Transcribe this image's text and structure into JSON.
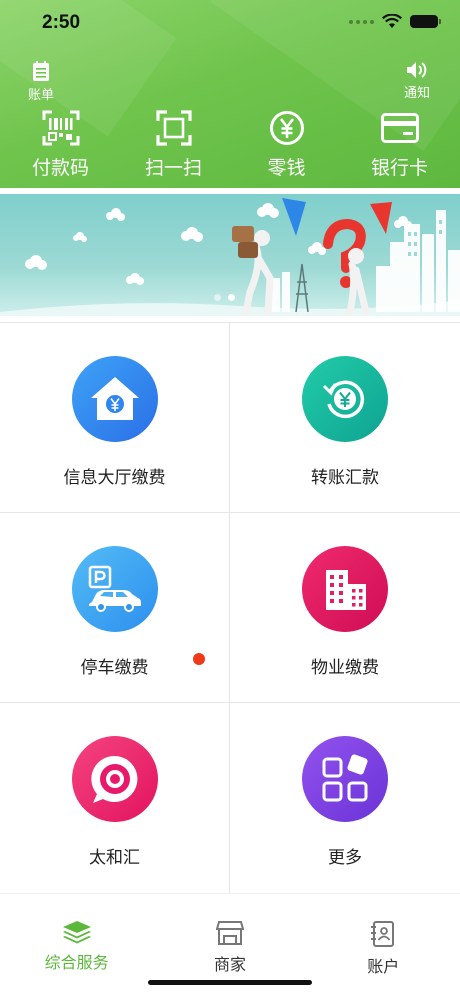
{
  "status_bar": {
    "time": "2:50"
  },
  "header": {
    "bill": {
      "label": "账单",
      "icon": "bill-list-icon"
    },
    "notice": {
      "label": "通知",
      "icon": "speaker-icon"
    },
    "quick_actions": [
      {
        "label": "付款码",
        "icon": "barcode-icon"
      },
      {
        "label": "扫一扫",
        "icon": "scan-frame-icon"
      },
      {
        "label": "零钱",
        "icon": "yuan-coin-icon"
      },
      {
        "label": "银行卡",
        "icon": "bank-card-icon"
      }
    ]
  },
  "banner": {
    "page_count": 2,
    "active_page": 2
  },
  "services": [
    {
      "label": "信息大厅缴费",
      "icon": "house-yuan-icon",
      "color": "#2f8ff0"
    },
    {
      "label": "转账汇款",
      "icon": "yuan-refresh-icon",
      "color": "#16b79a"
    },
    {
      "label": "停车缴费",
      "icon": "parking-car-icon",
      "color": "#3da7f2",
      "has_badge": true
    },
    {
      "label": "物业缴费",
      "icon": "building-icon",
      "color": "#e6195e"
    },
    {
      "label": "太和汇",
      "icon": "location-ring-icon",
      "color": "#ee2272"
    },
    {
      "label": "更多",
      "icon": "grid-more-icon",
      "color": "#7b3fe0"
    }
  ],
  "tabbar": {
    "active_color": "#5cb83c",
    "tabs": [
      {
        "label": "综合服务",
        "icon": "layers-icon",
        "active": true
      },
      {
        "label": "商家",
        "icon": "store-icon",
        "active": false
      },
      {
        "label": "账户",
        "icon": "account-book-icon",
        "active": false
      }
    ]
  }
}
